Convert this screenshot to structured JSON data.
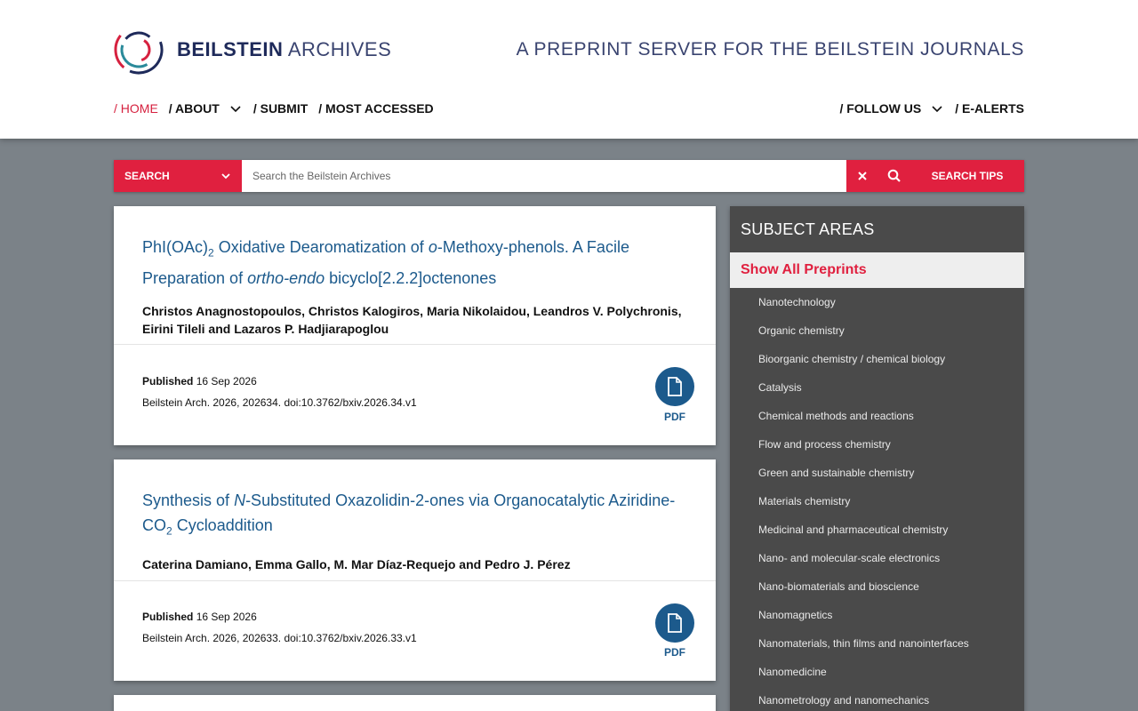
{
  "header": {
    "brand_bold": "BEILSTEIN",
    "brand_light": "ARCHIVES",
    "tagline": "A PREPRINT SERVER FOR THE BEILSTEIN JOURNALS"
  },
  "nav": {
    "home": "/ HOME",
    "about": "/ ABOUT",
    "submit": "/ SUBMIT",
    "most_accessed": "/ MOST ACCESSED",
    "follow_us": "/ FOLLOW US",
    "e_alerts": "/ E-ALERTS"
  },
  "search": {
    "select_label": "SEARCH",
    "placeholder": "Search the Beilstein Archives",
    "tips_label": "SEARCH TIPS"
  },
  "articles": [
    {
      "title_parts": [
        "PhI(OAc)",
        "2",
        " Oxidative Dearomatization of ",
        "o",
        "-Methoxy-phenols. A Facile Preparation of ",
        "ortho-endo",
        " bicyclo[2.2.2]octenones"
      ],
      "authors": "Christos Anagnostopoulos, Christos Kalogiros, Maria Nikolaidou, Leandros V. Polychronis, Eirini Tileli and Lazaros P. Hadjiarapoglou",
      "published_label": "Published",
      "published_date": "16 Sep 2026",
      "citation": "Beilstein Arch. 2026, 202634. doi:10.3762/bxiv.2026.34.v1",
      "pdf_label": "PDF"
    },
    {
      "title_parts": [
        "Synthesis of ",
        "N",
        "-Substituted Oxazolidin-2-ones via Organocatalytic Aziridine-CO",
        "2",
        " Cycloaddition"
      ],
      "authors": "Caterina Damiano, Emma Gallo, M. Mar Díaz-Requejo and Pedro J. Pérez",
      "published_label": "Published",
      "published_date": "16 Sep 2026",
      "citation": "Beilstein Arch. 2026, 202633. doi:10.3762/bxiv.2026.33.v1",
      "pdf_label": "PDF"
    }
  ],
  "sidebar": {
    "heading": "SUBJECT AREAS",
    "show_all": "Show All Preprints",
    "items": [
      "Nanotechnology",
      "Organic chemistry",
      "Bioorganic chemistry / chemical biology",
      "Catalysis",
      "Chemical methods and reactions",
      "Flow and process chemistry",
      "Green and sustainable chemistry",
      "Materials chemistry",
      "Medicinal and pharmaceutical chemistry",
      "Nano- and molecular-scale electronics",
      "Nano-biomaterials and bioscience",
      "Nanomagnetics",
      "Nanomaterials, thin films and nanointerfaces",
      "Nanomedicine",
      "Nanometrology and nanomechanics"
    ]
  },
  "colors": {
    "accent": "#e0203f",
    "link": "#1c5a8c",
    "sidebar_bg": "#4a4a4a",
    "page_bg": "#7b8288"
  }
}
